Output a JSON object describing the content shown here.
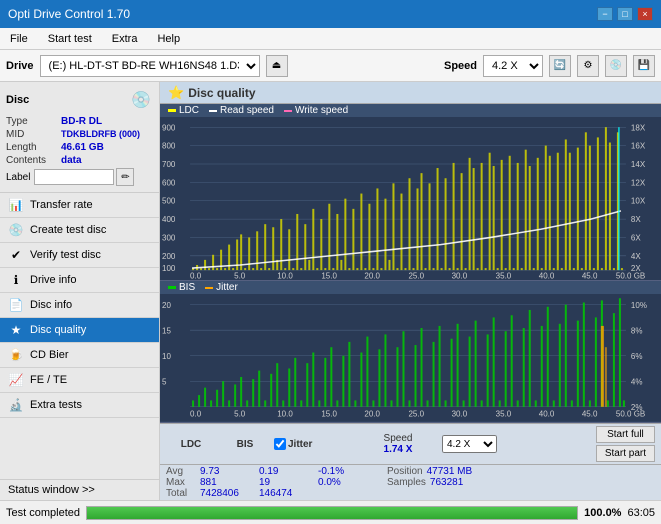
{
  "titleBar": {
    "title": "Opti Drive Control 1.70",
    "minimize": "−",
    "maximize": "□",
    "close": "×"
  },
  "menuBar": {
    "items": [
      "File",
      "Start test",
      "Extra",
      "Help"
    ]
  },
  "driveBar": {
    "label": "Drive",
    "driveValue": "(E:)  HL-DT-ST BD-RE  WH16NS48 1.D3",
    "speedLabel": "Speed",
    "speedValue": "4.2 X"
  },
  "disc": {
    "title": "Disc",
    "fields": [
      {
        "label": "Type",
        "value": "BD-R DL"
      },
      {
        "label": "MID",
        "value": "TDKBLDRFB (000)"
      },
      {
        "label": "Length",
        "value": "46.61 GB"
      },
      {
        "label": "Contents",
        "value": "data"
      }
    ],
    "labelFieldLabel": "Label",
    "labelValue": ""
  },
  "sidebar": {
    "items": [
      {
        "id": "transfer-rate",
        "label": "Transfer rate",
        "icon": "📊"
      },
      {
        "id": "create-test-disc",
        "label": "Create test disc",
        "icon": "💿"
      },
      {
        "id": "verify-test-disc",
        "label": "Verify test disc",
        "icon": "✔"
      },
      {
        "id": "drive-info",
        "label": "Drive info",
        "icon": "ℹ"
      },
      {
        "id": "disc-info",
        "label": "Disc info",
        "icon": "📄"
      },
      {
        "id": "disc-quality",
        "label": "Disc quality",
        "icon": "★",
        "active": true
      },
      {
        "id": "cd-bier",
        "label": "CD Bier",
        "icon": "🍺"
      },
      {
        "id": "fe-te",
        "label": "FE / TE",
        "icon": "📈"
      },
      {
        "id": "extra-tests",
        "label": "Extra tests",
        "icon": "🔬"
      }
    ],
    "statusWindow": "Status window >>"
  },
  "discQuality": {
    "title": "Disc quality",
    "legend": {
      "ldc": "LDC",
      "readSpeed": "Read speed",
      "writeSpeed": "Write speed",
      "bis": "BIS",
      "jitter": "Jitter"
    }
  },
  "stats": {
    "columns": [
      "LDC",
      "BIS",
      "",
      "Jitter",
      "Speed",
      ""
    ],
    "avg": {
      "ldc": "9.73",
      "bis": "0.19",
      "jitter": "-0.1%",
      "speed_label": "1.74 X",
      "speed_val": "4.2 X"
    },
    "max": {
      "ldc": "881",
      "bis": "19",
      "jitter": "0.0%"
    },
    "total": {
      "ldc": "7428406",
      "bis": "146474"
    },
    "position": {
      "label": "Position",
      "value": "47731 MB"
    },
    "samples": {
      "label": "Samples",
      "value": "763281"
    },
    "startFull": "Start full",
    "startPart": "Start part"
  },
  "statusBar": {
    "text": "Test completed",
    "progress": 100,
    "progressText": "100.0%",
    "time": "63:05"
  },
  "colors": {
    "accent": "#1a73c0",
    "chartBg": "#2a3a55",
    "gridLine": "#4a6080",
    "ldc": "#ffff00",
    "bis": "#00ff00",
    "readSpeed": "#ffffff",
    "writeSpeed": "#ff69b4",
    "jitter": "#ffa500"
  }
}
